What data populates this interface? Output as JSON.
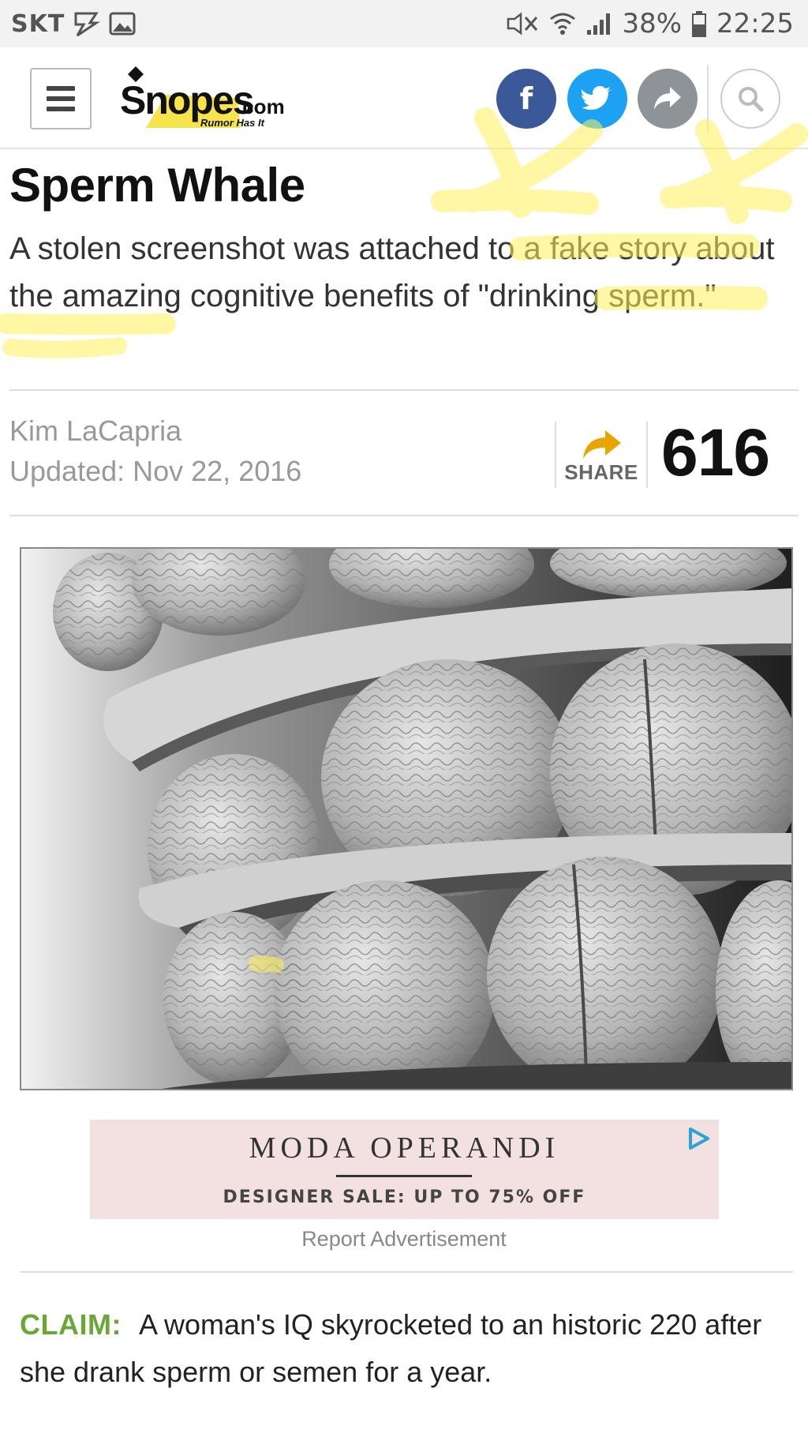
{
  "status_bar": {
    "carrier": "SKT",
    "battery": "38%",
    "time": "22:25"
  },
  "header": {
    "logo_text": "Snopes",
    "logo_suffix": ".com",
    "logo_tagline": "Rumor Has It",
    "facebook_label": "f",
    "icons": [
      "menu-icon",
      "facebook-icon",
      "twitter-icon",
      "share-icon",
      "search-icon"
    ]
  },
  "article": {
    "title": "Sperm Whale",
    "subtitle": "A stolen screenshot was attached to a fake story about the amazing cognitive benefits of \"drinking sperm.\"",
    "author": "Kim LaCapria",
    "updated": "Updated: Nov 22, 2016",
    "share_label": "SHARE",
    "share_count": "616"
  },
  "ad": {
    "brand": "MODA OPERANDI",
    "tagline": "DESIGNER SALE: UP TO 75% OFF",
    "report": "Report Advertisement"
  },
  "claim": {
    "label": "CLAIM:",
    "text": "A woman's IQ skyrocketed to an historic 220 after she drank sperm or semen for a year."
  },
  "colors": {
    "facebook": "#3b5998",
    "twitter": "#1da1f2",
    "share": "#8e9398",
    "claim_label": "#6aa834",
    "share_arrow": "#e8a500",
    "logo_yellow": "#f7e34b",
    "highlight": "#fff05a"
  }
}
